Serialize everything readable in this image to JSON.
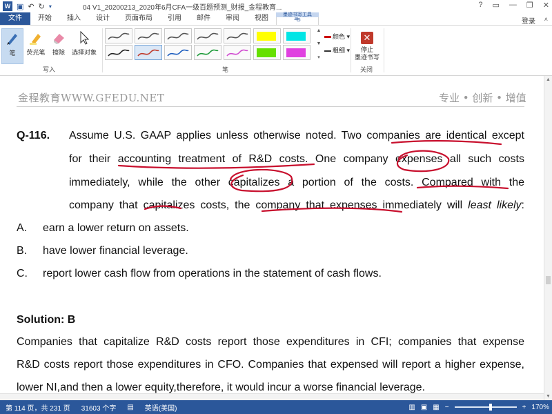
{
  "titlebar": {
    "logo": "W",
    "doc_title": "04 V1_20200213_2020年6月CFA一级百题预测_财报_金程教育...",
    "controls": [
      "?",
      "▭",
      "—",
      "❐",
      "✕"
    ]
  },
  "tabs": {
    "file": "文件",
    "items": [
      "开始",
      "插入",
      "设计",
      "页面布局",
      "引用",
      "邮件",
      "审阅",
      "视图"
    ],
    "contextual_group": "墨迹书写工具",
    "active": "笔",
    "login": "登录"
  },
  "ribbon": {
    "write_group": {
      "label": "写入",
      "pen": "笔",
      "highlighter": "荧光笔",
      "eraser": "擦除",
      "select": "选择对象"
    },
    "pens_group": {
      "label": "笔",
      "color_label": "颜色",
      "thickness_label": "粗细",
      "colors": [
        "#555555",
        "#555555",
        "#555555",
        "#555555",
        "#555555",
        "#ffff00",
        "#00e5e5",
        "#222222",
        "#c0392b",
        "#1f5fbf",
        "#1e9b3a",
        "#d04ad0",
        "#66e000",
        "#e040e0"
      ]
    },
    "close_group": {
      "label": "关闭",
      "stop": "停止\n墨迹书写"
    }
  },
  "document": {
    "header_left": "金程教育WWW.GFEDU.NET",
    "header_right": "专业 • 创新 • 增值",
    "question_number": "Q-116.",
    "question_lines": [
      "Assume U.S. GAAP applies unless otherwise noted. Two companies are identical except",
      "for their accounting treatment of R&D costs. One company expenses all such costs",
      "immediately, while the other capitalizes a portion of the costs. Compared with the"
    ],
    "question_last_start": "company that capitalizes costs, the company that expenses immediately will ",
    "question_last_italic": "least likely",
    "question_last_end": ":",
    "options": [
      {
        "letter": "A.",
        "text": "earn a lower return on assets."
      },
      {
        "letter": "B.",
        "text": "have lower financial leverage."
      },
      {
        "letter": "C.",
        "text": "report lower cash flow from operations in the statement of cash flows."
      }
    ],
    "solution_title": "Solution: B",
    "solution_lines": [
      "Companies that capitalize R&D costs report those expenditures in CFI; companies that expense",
      "R&D costs report those expenditures in CFO. Companies that expensed will report a higher expense,",
      "lower NI,and then a lower equity,therefore, it would incur a worse financial leverage."
    ]
  },
  "statusbar": {
    "page": "第 114 页，共 231 页",
    "words": "31603 个字",
    "language": "英语(美国)",
    "zoom": "170%"
  }
}
